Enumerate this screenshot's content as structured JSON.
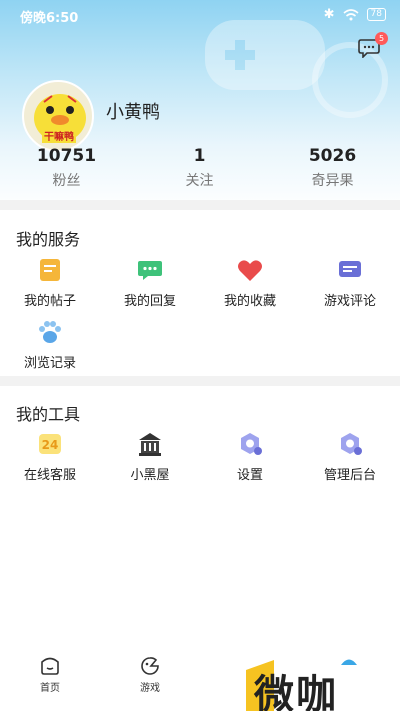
{
  "statusbar": {
    "time": "傍晚6:50",
    "battery": "78"
  },
  "header": {
    "message_badge": "5"
  },
  "profile": {
    "name": "小黄鸭",
    "avatar_text": "干嘛鸭"
  },
  "stats": [
    {
      "value": "10751",
      "label": "粉丝"
    },
    {
      "value": "1",
      "label": "关注"
    },
    {
      "value": "5026",
      "label": "奇异果"
    }
  ],
  "services": {
    "title": "我的服务",
    "items": [
      {
        "label": "我的帖子",
        "icon": "post-icon"
      },
      {
        "label": "我的回复",
        "icon": "reply-icon"
      },
      {
        "label": "我的收藏",
        "icon": "heart-icon"
      },
      {
        "label": "游戏评论",
        "icon": "comment-icon"
      },
      {
        "label": "浏览记录",
        "icon": "paw-icon"
      }
    ]
  },
  "tools": {
    "title": "我的工具",
    "items": [
      {
        "label": "在线客服",
        "icon": "service-24-icon",
        "icon_text": "24"
      },
      {
        "label": "小黑屋",
        "icon": "building-icon"
      },
      {
        "label": "设置",
        "icon": "settings-icon"
      },
      {
        "label": "管理后台",
        "icon": "admin-icon"
      }
    ]
  },
  "tabbar": [
    {
      "label": "首页",
      "icon": "home-icon"
    },
    {
      "label": "游戏",
      "icon": "game-icon"
    }
  ],
  "watermark": "微咖",
  "colors": {
    "accent": "#3aa7e6",
    "heart": "#e94b4b",
    "post": "#f5b63a",
    "reply": "#3ec27a",
    "tool": "#6a6fd6"
  }
}
